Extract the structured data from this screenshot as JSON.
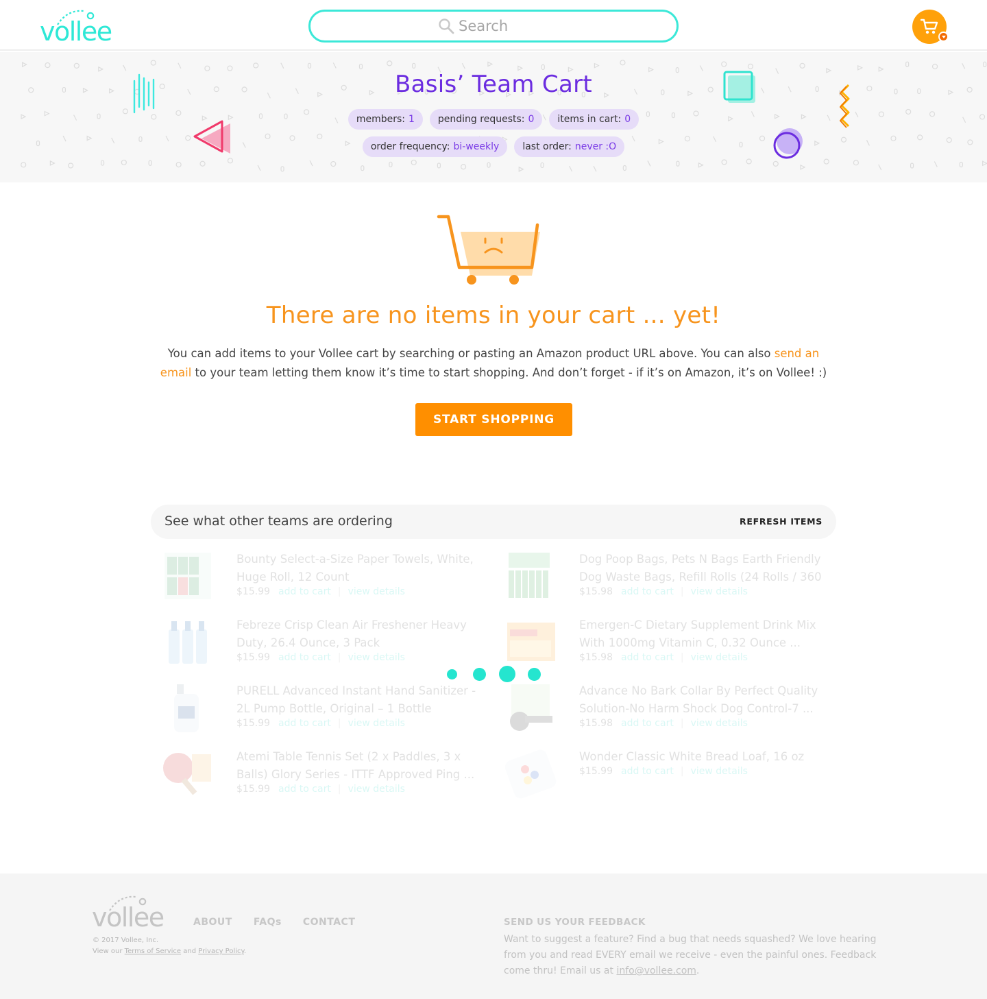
{
  "header": {
    "logo_text": "vollee",
    "search_placeholder": "Search"
  },
  "colors": {
    "teal": "#2ee8d6",
    "purple": "#6b2ce0",
    "orange": "#f7941d",
    "button_orange": "#ff8f00",
    "pill_bg": "#e6dcf8"
  },
  "banner": {
    "title": "Basis’ Team Cart",
    "stats_row1": [
      {
        "label": "members:",
        "value": "1"
      },
      {
        "label": "pending requests:",
        "value": "0"
      },
      {
        "label": "items in cart:",
        "value": "0"
      }
    ],
    "stats_row2": [
      {
        "label": "order frequency:",
        "value": "bi-weekly"
      },
      {
        "label": "last order:",
        "value": "never :O"
      }
    ]
  },
  "empty_cart": {
    "heading": "There are no items in your cart ... yet!",
    "desc_part1": "You can add items to your Vollee cart by searching or pasting an Amazon product URL above. You can also ",
    "desc_link": "send an email",
    "desc_part2": " to your team letting them know it’s time to start shopping. And don’t forget - if it’s on Amazon, it’s on Vollee! :)",
    "button_label": "START SHOPPING"
  },
  "others": {
    "title": "See what other teams are ordering",
    "refresh_label": "REFRESH ITEMS",
    "products": [
      {
        "name": "Bounty Select-a-Size Paper Towels, White, Huge Roll, 12 Count",
        "price": "$15.99",
        "add": "add to cart",
        "view": "view details",
        "icon": "paper-towels-thumb"
      },
      {
        "name": "Dog Poop Bags, Pets N Bags Earth Friendly Dog Waste Bags, Refill Rolls (24 Rolls / 360 ...",
        "price": "$15.98",
        "add": "add to cart",
        "view": "view details",
        "icon": "dog-bags-thumb"
      },
      {
        "name": "Febreze Crisp Clean Air Freshener Heavy Duty, 26.4 Ounce, 3 Pack",
        "price": "$15.99",
        "add": "add to cart",
        "view": "view details",
        "icon": "air-freshener-thumb"
      },
      {
        "name": "Emergen-C Dietary Supplement Drink Mix With 1000mg Vitamin C, 0.32 Ounce ...",
        "price": "$15.98",
        "add": "add to cart",
        "view": "view details",
        "icon": "emergen-c-thumb"
      },
      {
        "name": "PURELL Advanced Instant Hand Sanitizer - 2L Pump Bottle, Original – 1 Bottle",
        "price": "$15.99",
        "add": "add to cart",
        "view": "view details",
        "icon": "hand-sanitizer-thumb"
      },
      {
        "name": "Advance No Bark Collar By Perfect Quality Solution-No Harm Shock Dog Control-7 ...",
        "price": "$15.98",
        "add": "add to cart",
        "view": "view details",
        "icon": "bark-collar-thumb"
      },
      {
        "name": "Atemi Table Tennis Set (2 x Paddles, 3 x Balls) Glory Series - ITTF Approved Ping ...",
        "price": "$15.99",
        "add": "add to cart",
        "view": "view details",
        "icon": "ping-pong-thumb"
      },
      {
        "name": "Wonder Classic White Bread Loaf, 16 oz",
        "price": "$15.99",
        "add": "add to cart",
        "view": "view details",
        "icon": "bread-thumb"
      }
    ]
  },
  "footer": {
    "logo_text": "vollee",
    "copyright": "© 2017 Vollee, Inc.",
    "view_our": "View our",
    "terms": "Terms of Service",
    "and": "and",
    "privacy": "Privacy Policy",
    "period": ".",
    "nav": [
      "ABOUT",
      "FAQs",
      "CONTACT"
    ],
    "feedback_title": "SEND US YOUR FEEDBACK",
    "feedback_body": "Want to suggest a feature? Find a bug that needs squashed? We love hearing from you and read EVERY email we receive - even the painful ones. Feedback come thru! Email us at ",
    "feedback_email": "info@vollee.com",
    "feedback_end": "."
  }
}
